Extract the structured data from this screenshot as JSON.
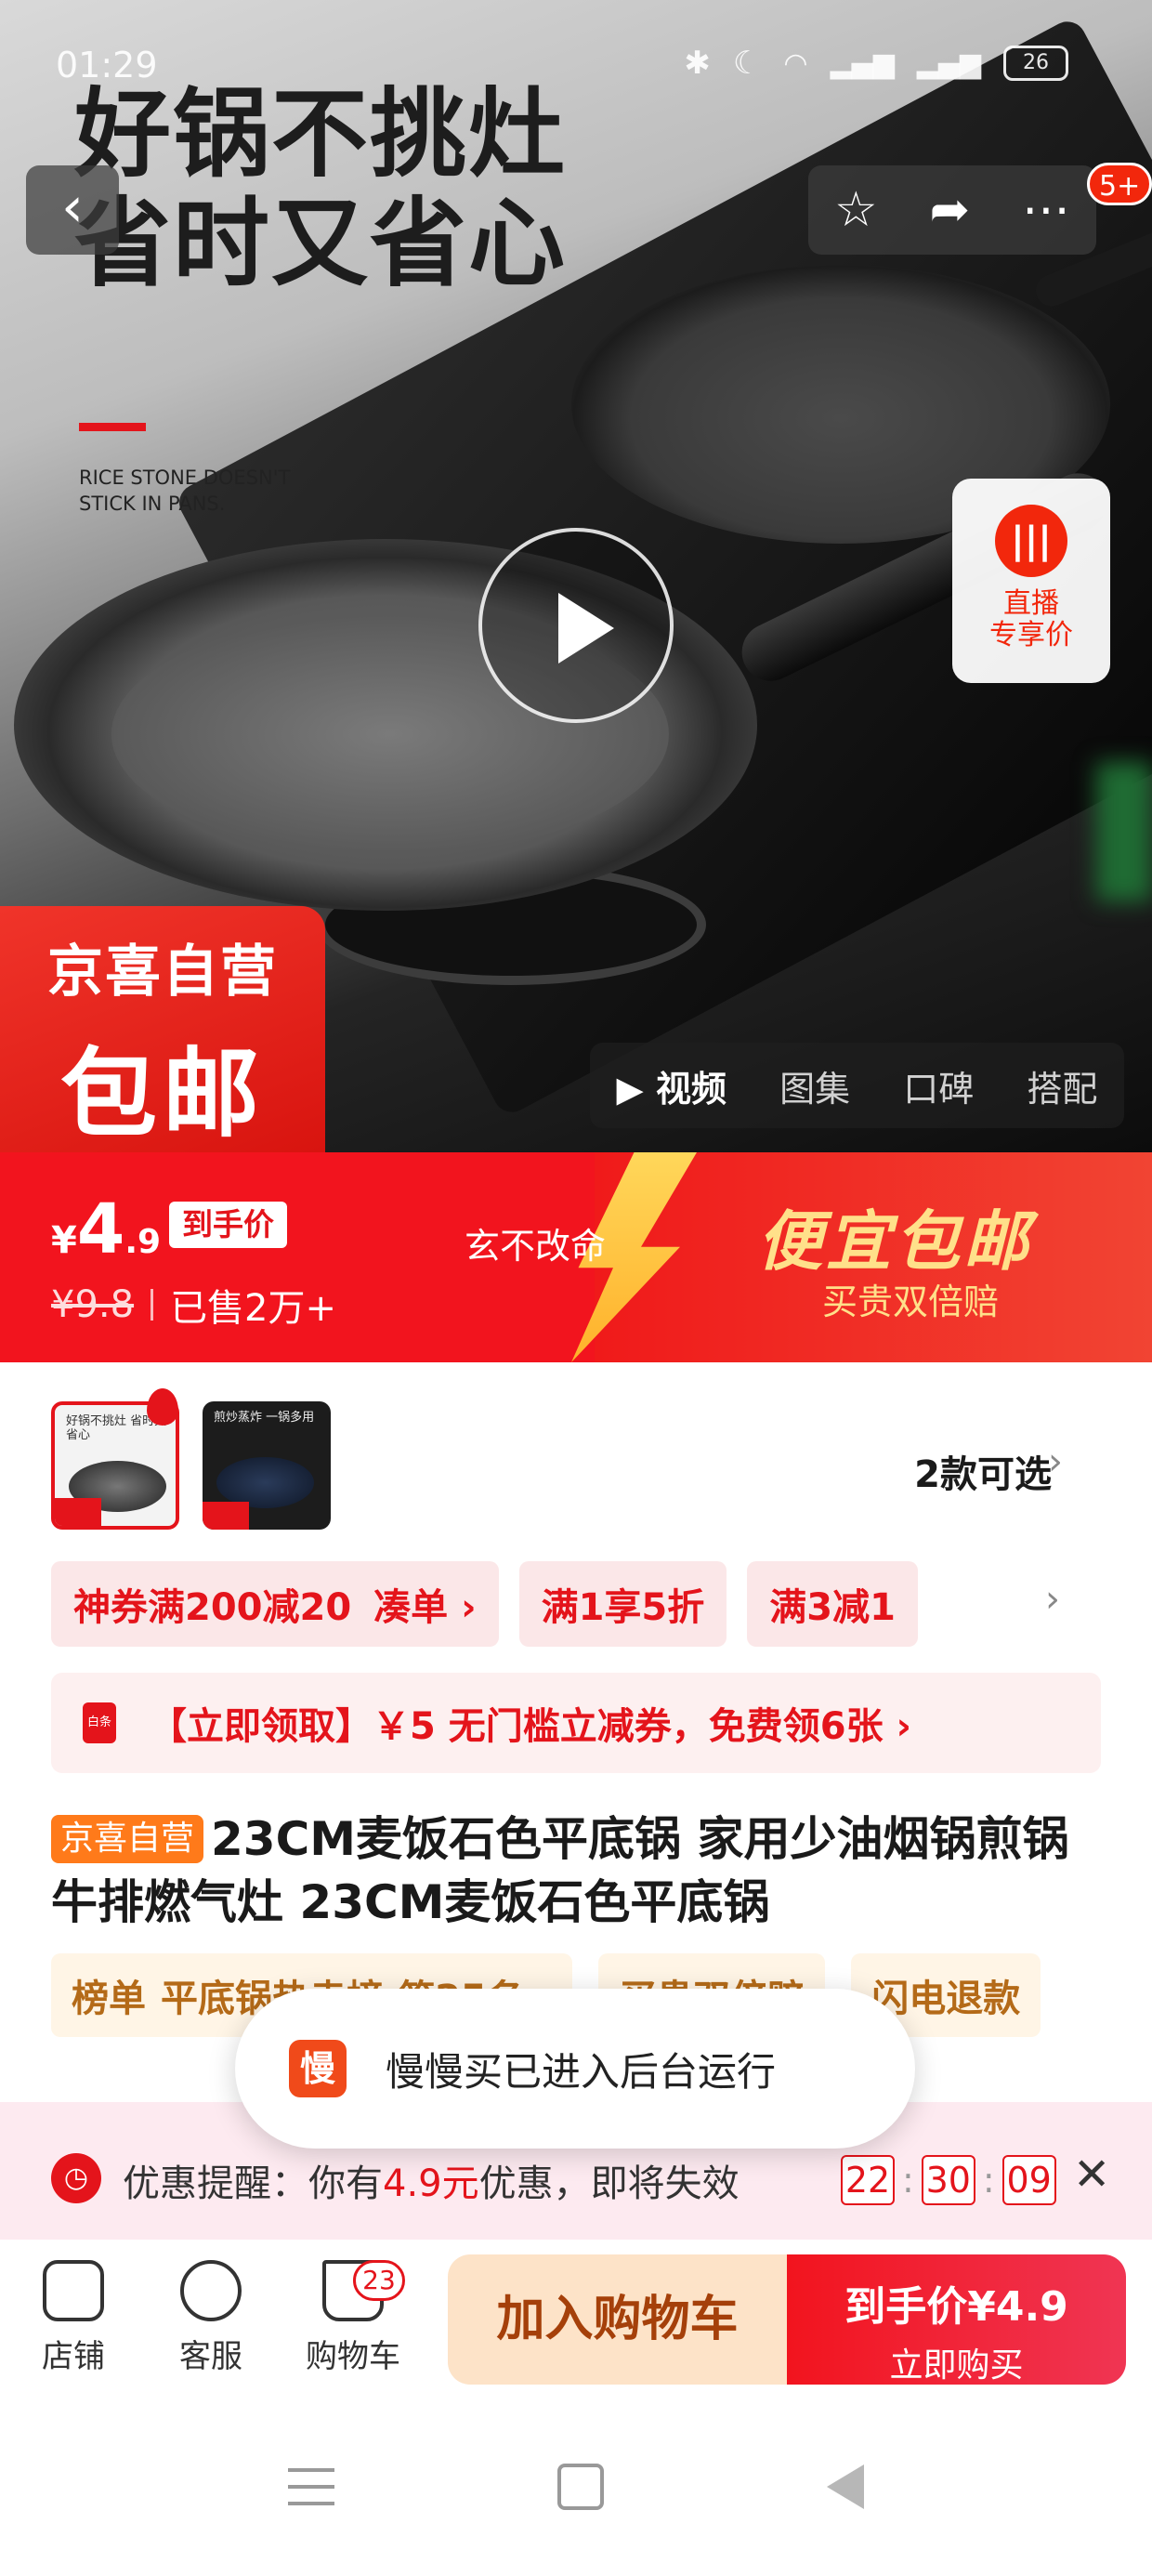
{
  "status_bar": {
    "time": "01:29",
    "battery": "26"
  },
  "hero": {
    "slogan_line1": "好锅不挑灶",
    "slogan_line2": "省时又省心",
    "slogan_sub": "RICE STONE DOESN'T STICK IN PANS.",
    "badge_count": "5+",
    "live_label_line1": "直播",
    "live_label_line2": "专享价",
    "corner_badge_line1": "京喜自营",
    "corner_badge_line2": "包邮",
    "media_tabs": [
      "视频",
      "图集",
      "口碑",
      "搭配"
    ]
  },
  "price_banner": {
    "currency": "¥",
    "price_int": "4",
    "price_dec": ".9",
    "price_tag": "到手价",
    "original_price": "¥9.8",
    "sold": "已售2万+",
    "middle_text": "玄不改命",
    "slogan": "便宜包邮",
    "slogan_sub": "买贵双倍赔"
  },
  "variants": {
    "thumb1_text": "好锅不挑灶 省时又省心",
    "thumb2_text": "煎炒蒸炸 一锅多用",
    "count_label": "2款可选"
  },
  "coupons": [
    {
      "main": "神券满200减20",
      "sub": "凑单 ›"
    },
    {
      "main": "满1享5折"
    },
    {
      "main": "满3减1"
    }
  ],
  "claim_bar": {
    "icon_text": "白条",
    "text": "【立即领取】￥5 无门槛立减券，免费领6张 ›"
  },
  "product": {
    "shop_tag": "京喜自营",
    "title": "23CM麦饭石色平底锅 家用少油烟锅煎锅牛排燃气灶 23CM麦饭石色平底锅"
  },
  "rank_chips": [
    {
      "label": "榜单",
      "value": "平底锅热卖榜·第25名 ›"
    },
    {
      "label": "买贵双倍赔"
    },
    {
      "label": "闪电退款"
    }
  ],
  "toast": {
    "icon_text": "慢",
    "text": "慢慢买已进入后台运行"
  },
  "promo_strip": {
    "prefix": "优惠提醒：你有",
    "amount": "4.9元",
    "suffix": "优惠，即将失效",
    "timer_h": "22",
    "timer_m": "30",
    "timer_s": "09"
  },
  "bottom_bar": {
    "shop_label": "店铺",
    "service_label": "客服",
    "cart_label": "购物车",
    "cart_count": "23",
    "add_cart_label": "加入购物车",
    "buy_line1": "到手价¥4.9",
    "buy_line2": "立即购买"
  },
  "colors": {
    "brand_red": "#e4141b",
    "accent_gold": "#ffe08a",
    "cart_button_bg": "#fde3c8"
  }
}
